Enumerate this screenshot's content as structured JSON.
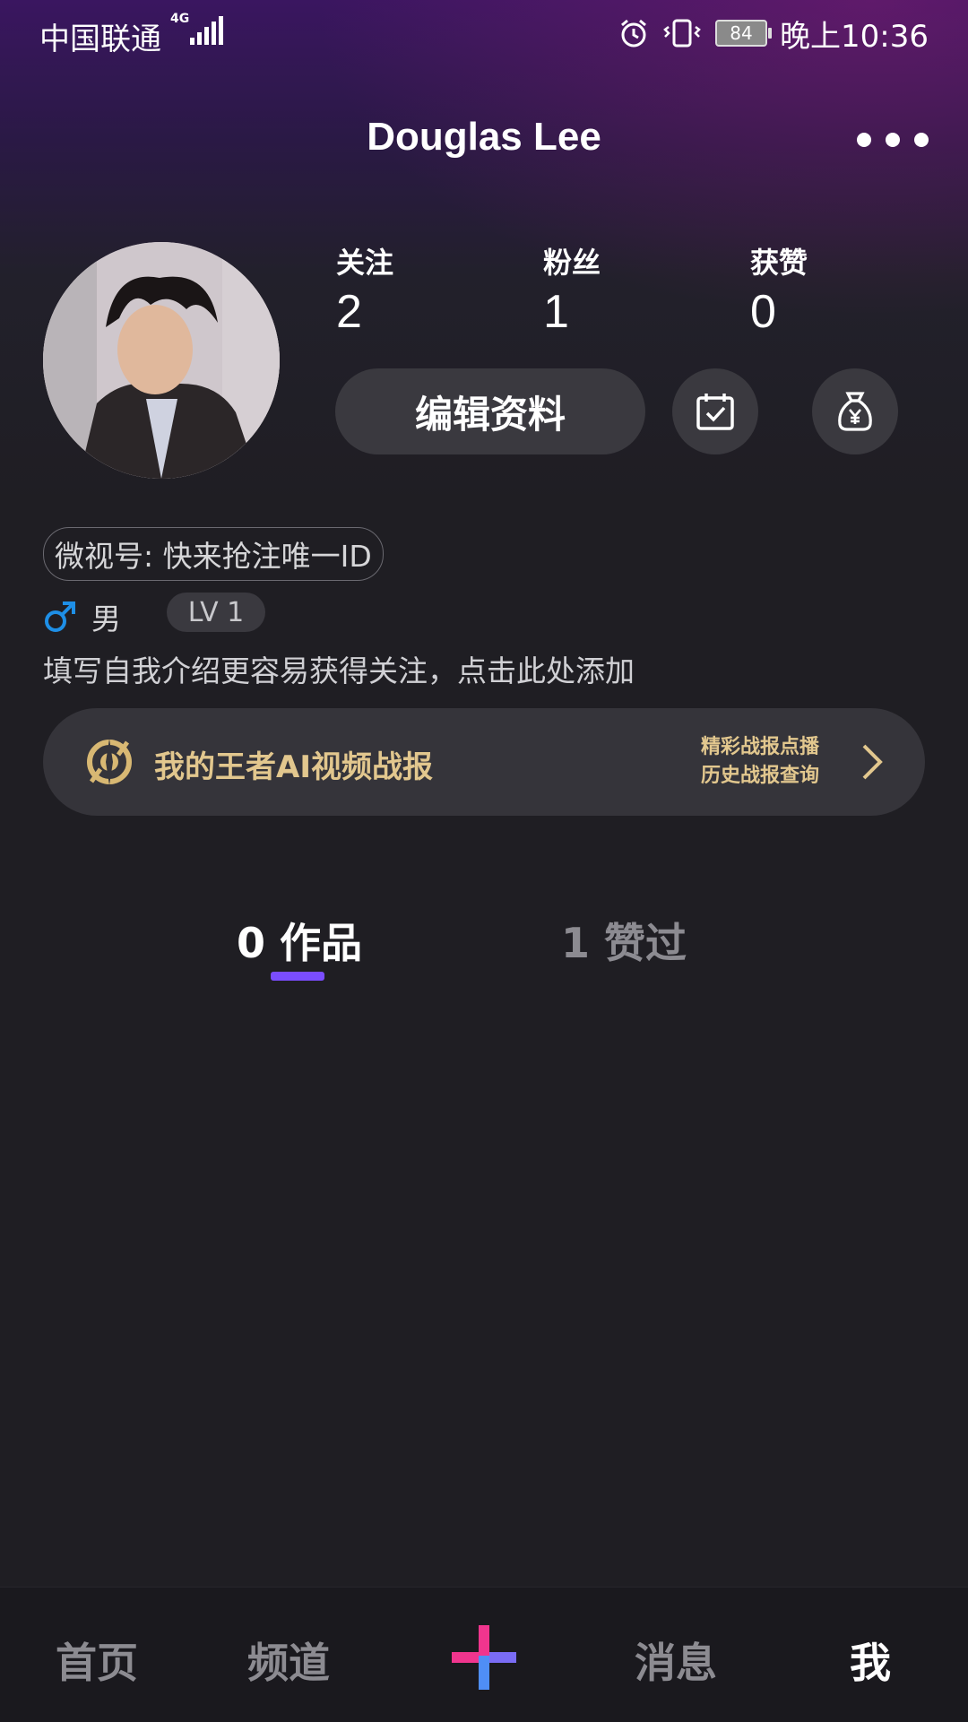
{
  "status_bar": {
    "carrier": "中国联通",
    "network": "4G",
    "battery": "84",
    "time": "晚上10:36"
  },
  "header": {
    "name": "Douglas Lee"
  },
  "stats": [
    {
      "label": "关注",
      "value": "2"
    },
    {
      "label": "粉丝",
      "value": "1"
    },
    {
      "label": "获赞",
      "value": "0"
    }
  ],
  "actions": {
    "edit_profile": "编辑资料"
  },
  "profile": {
    "weishi_id": "微视号: 快来抢注唯一ID",
    "gender": "男",
    "level": "LV 1",
    "bio_placeholder": "填写自我介绍更容易获得关注，点击此处添加"
  },
  "banner": {
    "title": "我的王者AI视频战报",
    "line1": "精彩战报点播",
    "line2": "历史战报查询"
  },
  "tabs": {
    "works": "0 作品",
    "liked": "1 赞过"
  },
  "nav": {
    "home": "首页",
    "channel": "频道",
    "messages": "消息",
    "me": "我"
  },
  "colors": {
    "accent_purple": "#7a4dff",
    "gold": "#e2c78e",
    "gender_blue": "#1e8fe6"
  }
}
